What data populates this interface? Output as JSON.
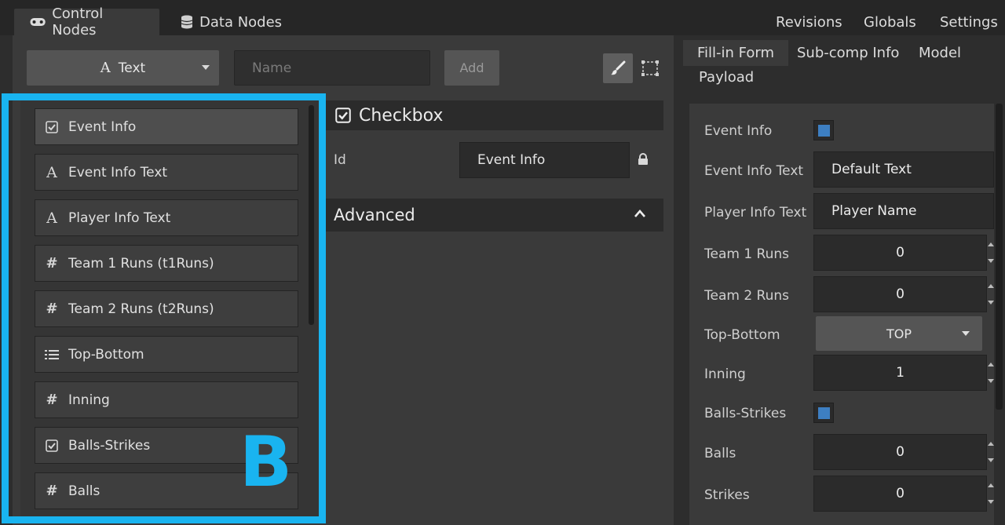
{
  "tabs": [
    {
      "label": "Control Nodes",
      "icon": "gamepad-icon",
      "active": true
    },
    {
      "label": "Data Nodes",
      "icon": "database-icon",
      "active": false
    }
  ],
  "topnav": [
    "Revisions",
    "Globals",
    "Settings"
  ],
  "toolbar": {
    "type_select": "Text",
    "name_placeholder": "Name",
    "add_label": "Add"
  },
  "nodes": [
    {
      "label": "Event Info",
      "icon": "checkbox-icon",
      "selected": true
    },
    {
      "label": "Event Info Text",
      "icon": "text-icon"
    },
    {
      "label": "Player Info Text",
      "icon": "text-icon"
    },
    {
      "label": "Team 1 Runs (t1Runs)",
      "icon": "number-icon"
    },
    {
      "label": "Team 2 Runs (t2Runs)",
      "icon": "number-icon"
    },
    {
      "label": "Top-Bottom",
      "icon": "list-icon"
    },
    {
      "label": "Inning",
      "icon": "number-icon"
    },
    {
      "label": "Balls-Strikes",
      "icon": "checkbox-icon"
    },
    {
      "label": "Balls",
      "icon": "number-icon"
    }
  ],
  "annotation": "B",
  "properties": {
    "header": "Checkbox",
    "id_label": "Id",
    "id_value": "Event Info",
    "advanced_label": "Advanced"
  },
  "right_tabs": [
    "Fill-in Form",
    "Sub-comp Info",
    "Model",
    "Payload"
  ],
  "form": {
    "event_info": {
      "label": "Event Info"
    },
    "event_info_text": {
      "label": "Event Info Text",
      "value": "Default Text"
    },
    "player_info_text": {
      "label": "Player Info Text",
      "value": "Player Name"
    },
    "team1_runs": {
      "label": "Team 1 Runs",
      "value": "0"
    },
    "team2_runs": {
      "label": "Team 2 Runs",
      "value": "0"
    },
    "top_bottom": {
      "label": "Top-Bottom",
      "value": "TOP"
    },
    "inning": {
      "label": "Inning",
      "value": "1"
    },
    "balls_strikes": {
      "label": "Balls-Strikes"
    },
    "balls": {
      "label": "Balls",
      "value": "0"
    },
    "strikes": {
      "label": "Strikes",
      "value": "0"
    }
  },
  "colors": {
    "accent": "#19b4f0",
    "checkbox_fill": "#3d7fc2"
  }
}
